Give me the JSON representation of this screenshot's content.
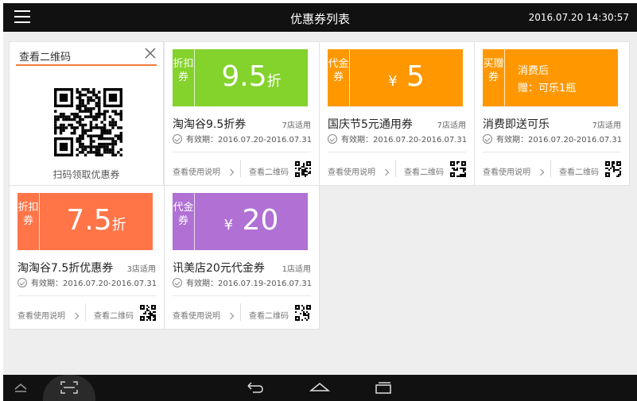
{
  "app": {
    "title": "优惠券列表",
    "clock": "2016.07.20 14:30:57"
  },
  "qr_panel": {
    "title": "查看二维码",
    "caption": "扫码领取优惠券"
  },
  "coupons": [
    {
      "side": "折扣券",
      "value": "9.5",
      "unit": "折",
      "name": "淘淘谷9.5折券",
      "stores": "7店适用",
      "validity": "有效期：2016.07.20-2016.07.31",
      "color": "#84d22c"
    },
    {
      "side": "代金券",
      "currency": "¥",
      "value": "5",
      "name": "国庆节5元通用券",
      "stores": "7店适用",
      "validity": "有效期：2016.07.20-2016.07.31",
      "color": "#ff9800"
    },
    {
      "side": "买赠券",
      "line1": "消费后",
      "line2": "赠：可乐1瓶",
      "name": "消费即送可乐",
      "stores": "7店适用",
      "validity": "有效期：2016.07.20-2016.07.31",
      "color": "#ff9800"
    },
    {
      "side": "折扣券",
      "value": "7.5",
      "unit": "折",
      "name": "淘淘谷7.5折优惠券",
      "stores": "3店适用",
      "validity": "有效期：2016.07.20-2016.07.31",
      "color": "#ff7548"
    },
    {
      "side": "代金券",
      "currency": "¥",
      "value": "20",
      "name": "讯美店20元代金券",
      "stores": "1店适用",
      "validity": "有效期：2016.07.19-2016.07.31",
      "color": "#b070d4"
    }
  ],
  "labels": {
    "usage": "查看使用说明",
    "qr": "查看二维码"
  },
  "icons": {
    "menu": "hamburger-icon",
    "close": "close-icon",
    "check": "check-circle-icon",
    "chevron": "chevron-right-icon",
    "qr": "qr-code-icon",
    "nav": [
      "collapse-up-icon",
      "scan-icon",
      "back-icon",
      "home-icon",
      "recents-icon"
    ]
  }
}
